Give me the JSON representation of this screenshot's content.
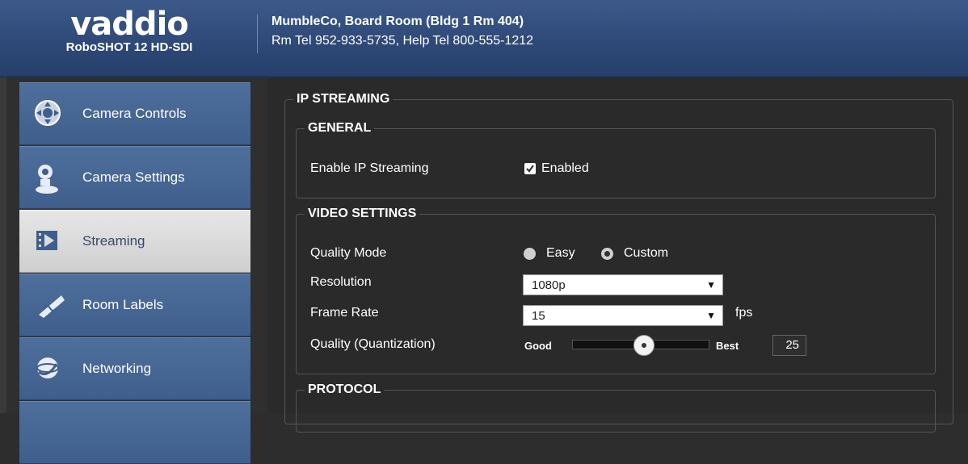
{
  "brand": {
    "logo_text": "vaddio",
    "model": "RoboSHOT 12 HD-SDI"
  },
  "room": {
    "title": "MumbleCo, Board Room (Bldg 1 Rm 404)",
    "phones": "Rm Tel 952-933-5735, Help Tel 800-555-1212"
  },
  "sidebar": {
    "items": [
      {
        "label": "Camera Controls",
        "icon": "camera-controls-icon",
        "active": false
      },
      {
        "label": "Camera Settings",
        "icon": "camera-settings-icon",
        "active": false
      },
      {
        "label": "Streaming",
        "icon": "streaming-icon",
        "active": true
      },
      {
        "label": "Room Labels",
        "icon": "room-labels-icon",
        "active": false
      },
      {
        "label": "Networking",
        "icon": "networking-icon",
        "active": false
      }
    ]
  },
  "content": {
    "section_title": "IP STREAMING",
    "general": {
      "legend": "GENERAL",
      "enable_label": "Enable IP Streaming",
      "enabled_text": "Enabled",
      "enabled_checked": true
    },
    "video": {
      "legend": "VIDEO SETTINGS",
      "quality_mode_label": "Quality Mode",
      "quality_mode_options": [
        "Easy",
        "Custom"
      ],
      "quality_mode_selected": "Custom",
      "resolution_label": "Resolution",
      "resolution_value": "1080p",
      "frame_rate_label": "Frame Rate",
      "frame_rate_value": "15",
      "frame_rate_unit": "fps",
      "quality_label": "Quality (Quantization)",
      "quality_min_label": "Good",
      "quality_max_label": "Best",
      "quality_value": "25",
      "quality_fraction": 0.52
    },
    "protocol": {
      "legend": "PROTOCOL"
    }
  },
  "colors": {
    "header_blue": "#2e4877",
    "nav_blue": "#4a6a98",
    "nav_active": "#dcdcdc",
    "panel_bg": "#2a2a2a"
  }
}
